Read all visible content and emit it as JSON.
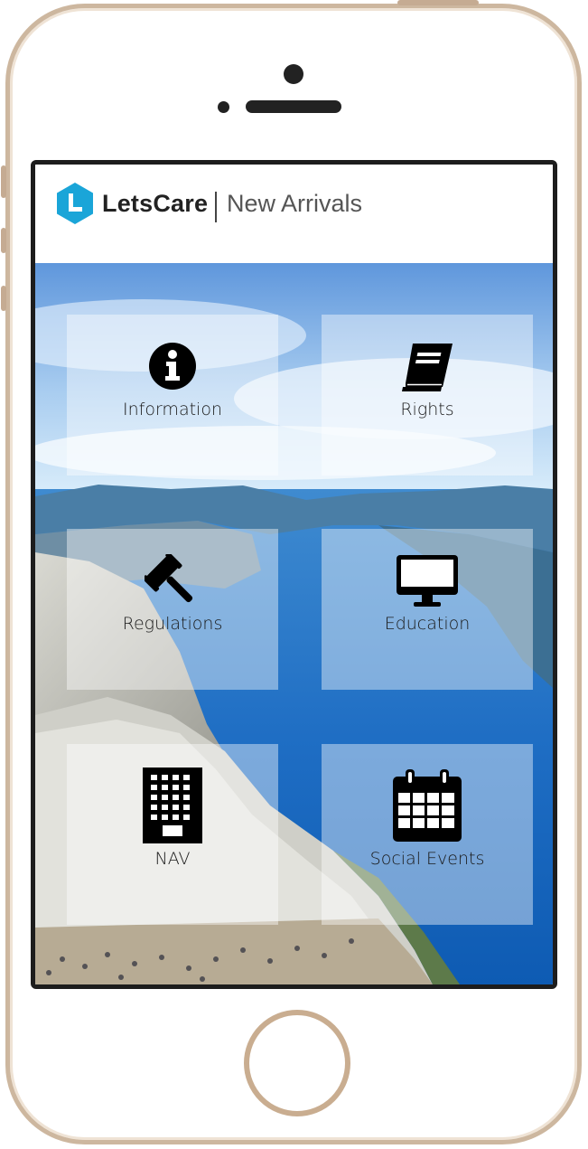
{
  "app": {
    "brand": "LetsCare",
    "subtitle": "New Arrivals"
  },
  "colors": {
    "brand_accent": "#1aa5d8",
    "frame_gold": "#cdb79f",
    "tile_overlay": "rgba(255,255,255,0.42)"
  },
  "tiles": [
    {
      "label": "Information",
      "icon": "info-circle-icon"
    },
    {
      "label": "Rights",
      "icon": "book-icon"
    },
    {
      "label": "Regulations",
      "icon": "gavel-icon"
    },
    {
      "label": "Education",
      "icon": "desktop-monitor-icon"
    },
    {
      "label": "NAV",
      "icon": "office-building-icon"
    },
    {
      "label": "Social Events",
      "icon": "calendar-icon"
    }
  ]
}
